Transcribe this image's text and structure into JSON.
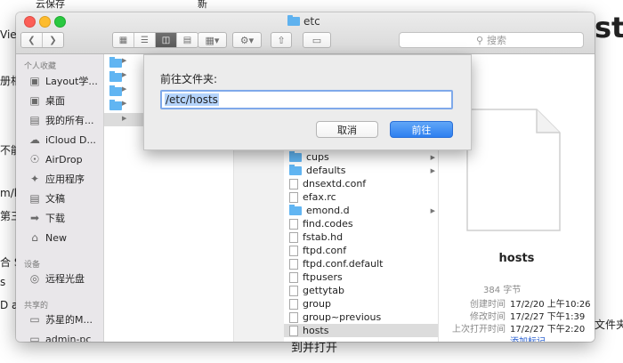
{
  "background": {
    "left_texts": [
      "View",
      "册相",
      "不能",
      "m/k",
      "第三",
      "合 S",
      "s",
      "D a"
    ],
    "top_texts": [
      "云保存",
      "新"
    ],
    "right_big": "st",
    "right_bottom": "文件夹",
    "bottom_text": "到并打开"
  },
  "window": {
    "title": "etc",
    "search_placeholder": "搜索"
  },
  "sidebar": {
    "favorites_header": "个人收藏",
    "favorites": [
      {
        "label": "Layout学...",
        "icon": "folder-icon"
      },
      {
        "label": "桌面",
        "icon": "desktop-icon"
      },
      {
        "label": "我的所有...",
        "icon": "all-files-icon"
      },
      {
        "label": "iCloud D...",
        "icon": "cloud-icon"
      },
      {
        "label": "AirDrop",
        "icon": "airdrop-icon"
      },
      {
        "label": "应用程序",
        "icon": "applications-icon"
      },
      {
        "label": "文稿",
        "icon": "documents-icon"
      },
      {
        "label": "下载",
        "icon": "download-icon"
      },
      {
        "label": "New",
        "icon": "home-icon"
      }
    ],
    "devices_header": "设备",
    "devices": [
      {
        "label": "远程光盘",
        "icon": "disc-icon"
      }
    ],
    "shared_header": "共享的",
    "shared": [
      {
        "label": "苏星的M...",
        "icon": "computer-icon"
      },
      {
        "label": "admin-pc",
        "icon": "computer-icon"
      }
    ]
  },
  "files": [
    {
      "name": "cups",
      "type": "folder",
      "has_children": true
    },
    {
      "name": "defaults",
      "type": "folder",
      "has_children": true
    },
    {
      "name": "dnsextd.conf",
      "type": "file"
    },
    {
      "name": "efax.rc",
      "type": "file"
    },
    {
      "name": "emond.d",
      "type": "folder",
      "has_children": true
    },
    {
      "name": "find.codes",
      "type": "file"
    },
    {
      "name": "fstab.hd",
      "type": "file"
    },
    {
      "name": "ftpd.conf",
      "type": "file"
    },
    {
      "name": "ftpd.conf.default",
      "type": "file"
    },
    {
      "name": "ftpusers",
      "type": "file"
    },
    {
      "name": "gettytab",
      "type": "file"
    },
    {
      "name": "group",
      "type": "file"
    },
    {
      "name": "group~previous",
      "type": "file"
    },
    {
      "name": "hosts",
      "type": "file",
      "selected": true
    }
  ],
  "preview": {
    "filename": "hosts",
    "size": "384 字节",
    "created_label": "创建时间",
    "created": "17/2/20 上午10:26",
    "modified_label": "修改时间",
    "modified": "17/2/27 下午1:39",
    "opened_label": "上次打开时间",
    "opened": "17/2/27 下午2:20",
    "add_tags": "添加标记..."
  },
  "dialog": {
    "label": "前往文件夹:",
    "value": "/etc/hosts",
    "cancel": "取消",
    "go": "前往"
  }
}
